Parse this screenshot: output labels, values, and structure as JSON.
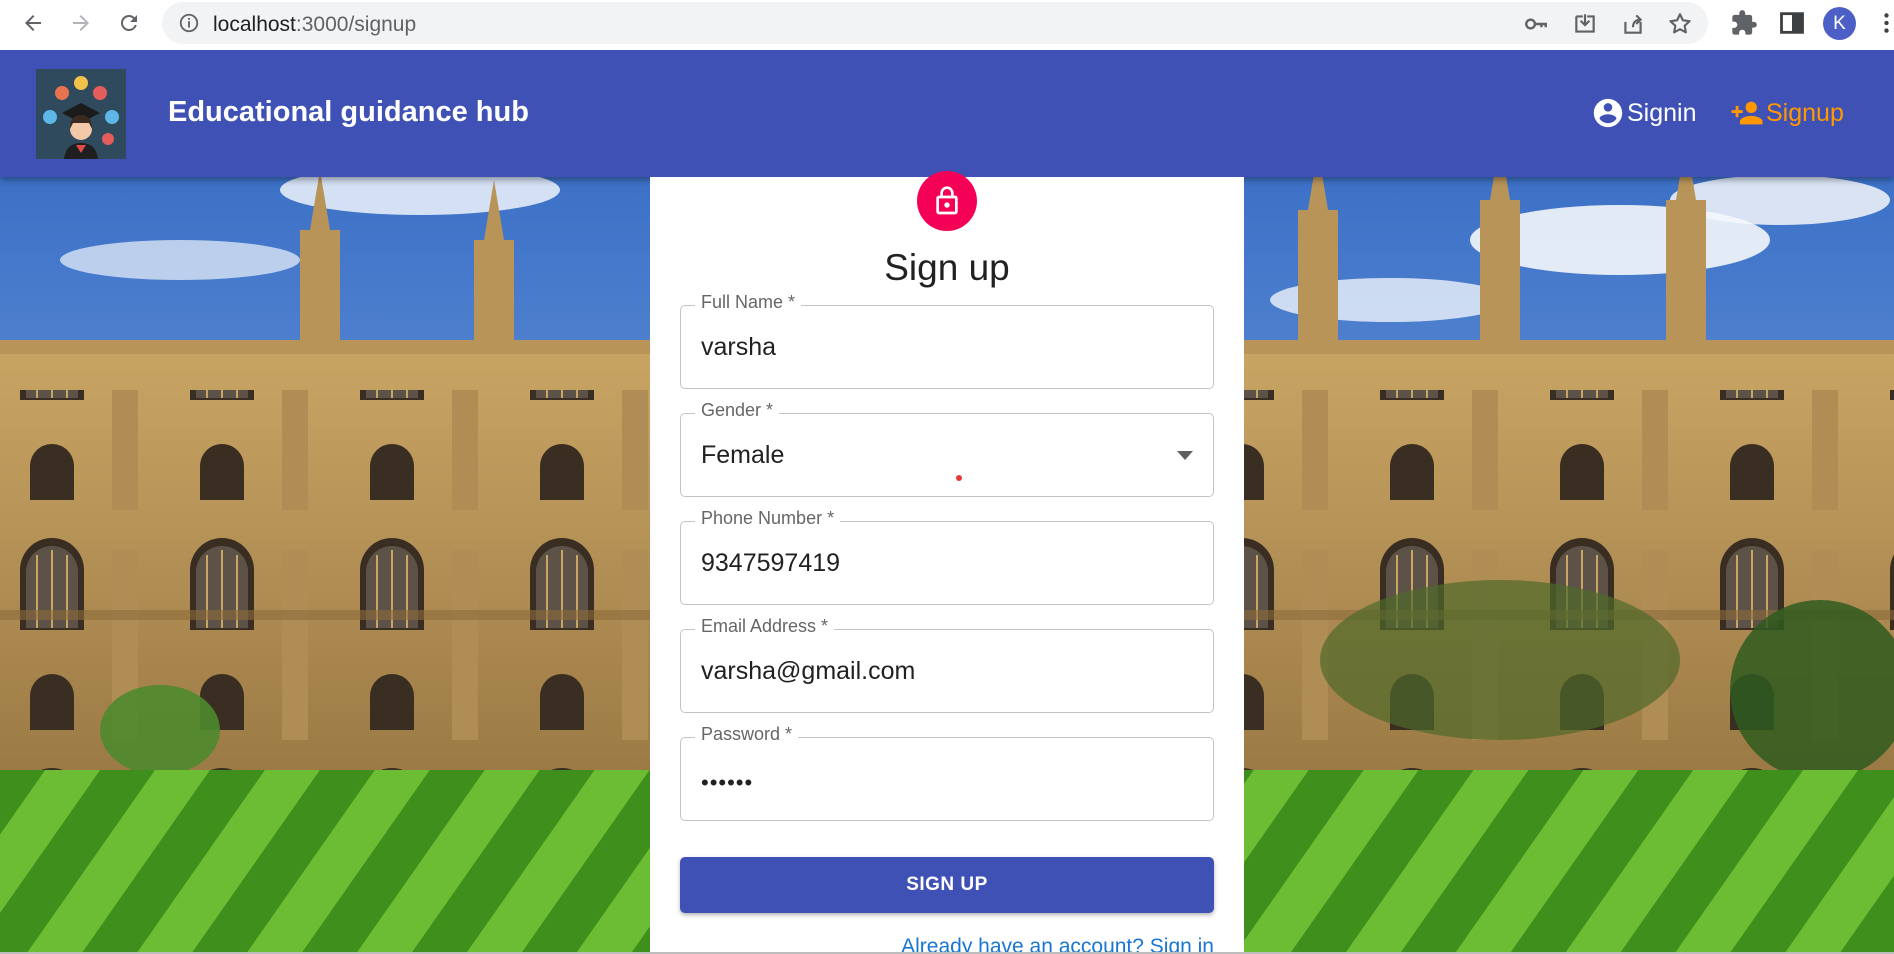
{
  "browser": {
    "url_host": "localhost",
    "url_path": ":3000/signup",
    "profile_initial": "K"
  },
  "appbar": {
    "title": "Educational guidance hub",
    "nav": [
      {
        "label": "Signin",
        "icon": "account-circle-icon",
        "color": "#ffffff"
      },
      {
        "label": "Signup",
        "icon": "person-add-icon",
        "color": "#ff9800"
      }
    ],
    "color": "#3f51b5"
  },
  "form": {
    "title": "Sign up",
    "avatar_icon": "lock-icon",
    "avatar_color": "#f50057",
    "fields": [
      {
        "label": "Full Name *",
        "value": "varsha"
      },
      {
        "label": "Gender *",
        "value": "Female"
      },
      {
        "label": "Phone Number *",
        "value": "9347597419"
      },
      {
        "label": "Email Address *",
        "value": "varsha@gmail.com"
      },
      {
        "label": "Password *",
        "value": "••••••"
      }
    ],
    "submit_label": "SIGN UP",
    "signin_link": "Already have an account? Sign in"
  }
}
